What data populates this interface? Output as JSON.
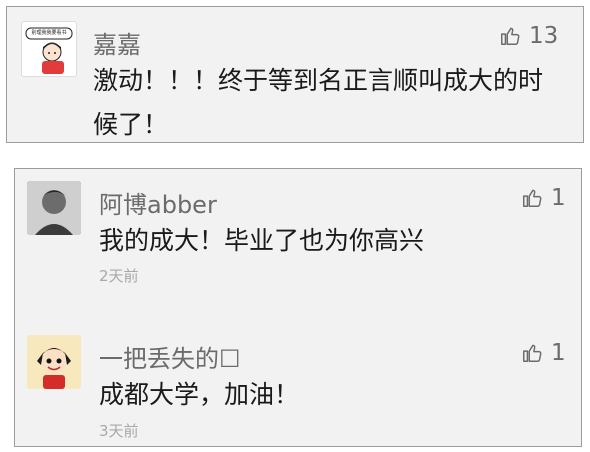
{
  "comments": [
    {
      "user": "嘉嘉",
      "avatar_caption": "别理我我要看书",
      "likes": "13",
      "text": "激动！！！终于等到名正言顺叫成大的时候了！"
    },
    {
      "user": "阿博abber",
      "likes": "1",
      "text": "我的成大！毕业了也为你高兴",
      "time": "2天前"
    },
    {
      "user": "一把丢失的☐",
      "likes": "1",
      "text": "成都大学，加油！",
      "time": "3天前"
    }
  ],
  "colors": {
    "card_bg": "#f2f2f2",
    "border": "#9c9c9c",
    "username": "#6b6b6b",
    "body_text": "#1a1a1a",
    "timestamp": "#a9a9a9"
  },
  "icons": {
    "like": "thumbs-up-icon"
  }
}
